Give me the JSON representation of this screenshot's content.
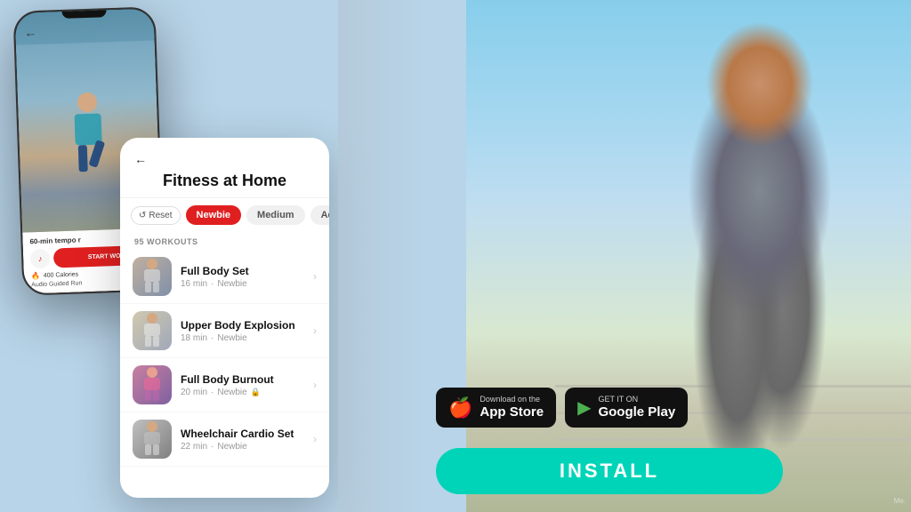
{
  "background": {
    "color_left": "#c5d8ea",
    "color_right": "#87CEEB"
  },
  "phone_left": {
    "back_label": "←",
    "running_text": "60-min tempo r",
    "start_label": "START WO",
    "calories": "400 Calories",
    "feature": "Audio Guided Run"
  },
  "app_screen": {
    "back_label": "←",
    "title": "Fitness at Home",
    "filters": {
      "reset_label": "Reset",
      "newbie_label": "Newbie",
      "medium_label": "Medium",
      "advanced_label": "Advance"
    },
    "workouts_count": "95 WORKOUTS",
    "workout_items": [
      {
        "name": "Full Body Set",
        "duration": "16 min",
        "level": "Newbie",
        "has_lock": false
      },
      {
        "name": "Upper Body Explosion",
        "duration": "18 min",
        "level": "Newbie",
        "has_lock": false
      },
      {
        "name": "Full Body Burnout",
        "duration": "20 min",
        "level": "Newbie",
        "has_lock": true
      },
      {
        "name": "Wheelchair Cardio Set",
        "duration": "22 min",
        "level": "Newbie",
        "has_lock": false
      }
    ]
  },
  "app_store": {
    "small_label": "Download on the",
    "large_label": "App Store",
    "icon": "🍎"
  },
  "google_play": {
    "small_label": "GET IT ON",
    "large_label": "Google Play",
    "icon": "▶"
  },
  "install_button": {
    "label": "INSTALL"
  },
  "watermark": "Me."
}
